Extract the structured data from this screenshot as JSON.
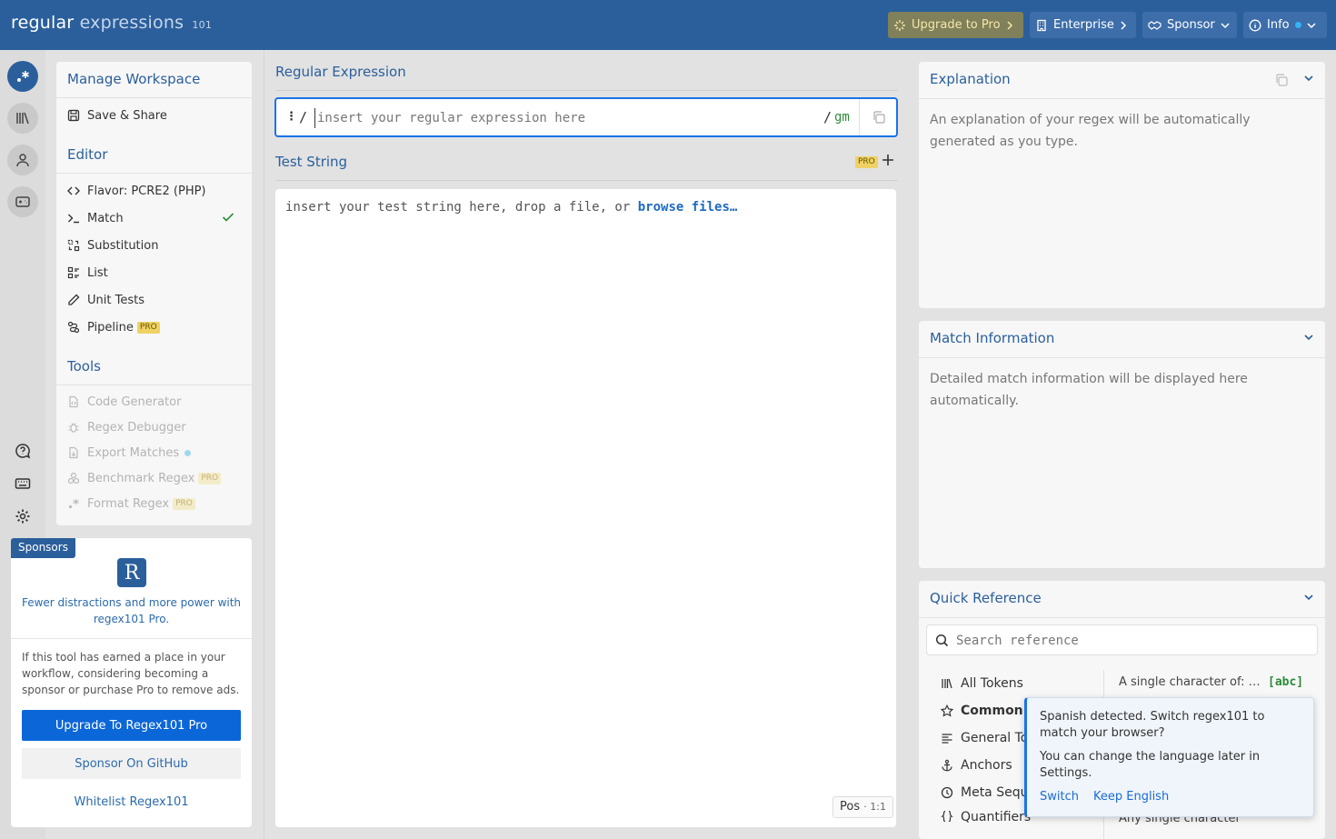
{
  "app": {
    "logo_main": "regular",
    "logo_accent": "expressions",
    "logo_sup": "101"
  },
  "topbar": {
    "upgrade": "Upgrade to Pro",
    "enterprise": "Enterprise",
    "sponsor": "Sponsor",
    "info": "Info"
  },
  "sidebar": {
    "workspace_title": "Manage Workspace",
    "save_share": "Save & Share",
    "editor_title": "Editor",
    "flavor_label": "Flavor:",
    "flavor_value": "PCRE2 (PHP)",
    "items": [
      {
        "label": "Match"
      },
      {
        "label": "Substitution"
      },
      {
        "label": "List"
      },
      {
        "label": "Unit Tests"
      },
      {
        "label": "Pipeline"
      }
    ],
    "pro_badge": "PRO",
    "tools_title": "Tools",
    "tools": [
      {
        "label": "Code Generator"
      },
      {
        "label": "Regex Debugger"
      },
      {
        "label": "Export Matches"
      },
      {
        "label": "Benchmark Regex"
      },
      {
        "label": "Format Regex"
      }
    ]
  },
  "sponsor": {
    "tag": "Sponsors",
    "logo_letter": "R",
    "pitch": "Fewer distractions and more power with regex101 Pro.",
    "text": "If this tool has earned a place in your workflow, considering becoming a sponsor or purchase Pro to remove ads.",
    "btn_upgrade": "Upgrade To Regex101 Pro",
    "btn_github": "Sponsor On GitHub",
    "btn_whitelist": "Whitelist Regex101"
  },
  "regex": {
    "title": "Regular Expression",
    "handle": "⋮",
    "delimiter": "/",
    "placeholder": "insert your regular expression here",
    "flags": "gm"
  },
  "test_string": {
    "title": "Test String",
    "pro_badge": "PRO",
    "placeholder_text": "insert your test string here, drop a file, or ",
    "browse_link": "browse files…",
    "pos_label": "Pos",
    "pos_value": "· 1:1"
  },
  "explanation": {
    "title": "Explanation",
    "body": "An explanation of your regex will be automatically generated as you type."
  },
  "match_info": {
    "title": "Match Information",
    "body": "Detailed match information will be displayed here automatically."
  },
  "quick_ref": {
    "title": "Quick Reference",
    "search_placeholder": "Search reference",
    "categories": [
      {
        "label": "All Tokens"
      },
      {
        "label": "Common Tokens"
      },
      {
        "label": "General Tokens"
      },
      {
        "label": "Anchors"
      },
      {
        "label": "Meta Sequences"
      },
      {
        "label": "Quantifiers"
      }
    ],
    "desc1": "A single character of: …",
    "token1": "[abc]",
    "desc2": "Any single character"
  },
  "lang_popup": {
    "message": "Spanish detected. Switch regex101 to match your browser?",
    "note": "You can change the language later in Settings.",
    "switch": "Switch",
    "keep": "Keep English"
  }
}
